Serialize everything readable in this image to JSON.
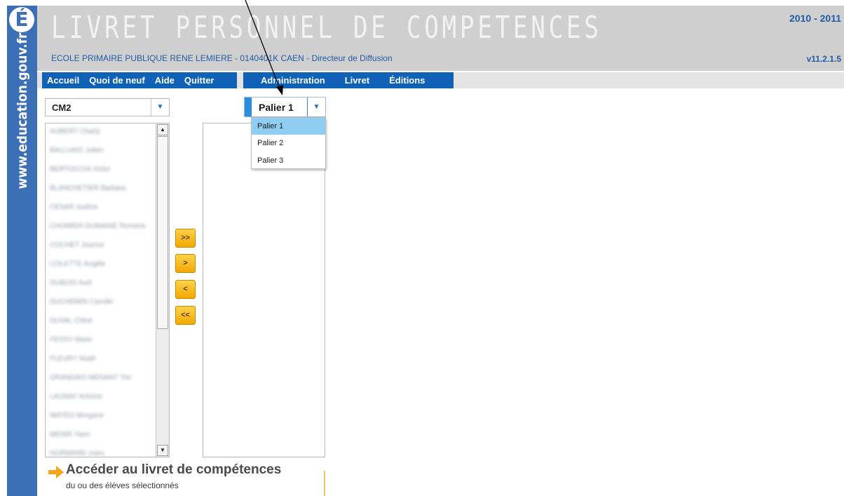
{
  "brand": {
    "logo_letter": "É",
    "url": "www.education.gouv.fr",
    "color": "#3b6fb6"
  },
  "header": {
    "title": "LIVRET PERSONNEL DE COMPETENCES",
    "school": "ECOLE PRIMAIRE PUBLIQUE RENE LEMIERE - 0140401K CAEN - Directeur de Diffusion",
    "year": "2010 - 2011",
    "version": "v11.2.1.5"
  },
  "nav": {
    "left": [
      "Accueil",
      "Quoi de neuf",
      "Aide",
      "Quitter"
    ],
    "right": [
      "Administration",
      "Livret",
      "Éditions"
    ],
    "color": "#0f62b6"
  },
  "class_select": {
    "value": "CM2"
  },
  "students": [
    "AUBERT Charly",
    "BALLUAIS Julien",
    "BERTOCCHI Victor",
    "BLANCHETIER Barbara",
    "CESAR Justine",
    "CHOMIER-DUMAINE Romane",
    "COCHET Jeanne",
    "COLETTE Angèle",
    "DUBOIS Axel",
    "DUCHEMIN Camille",
    "DUVAL Chloé",
    "FESSY Marie",
    "FLEURY Noah",
    "GRANDAIS-MENANT Tim",
    "LAUNAY Antoine",
    "MATÉO Morgane",
    "MENIR Yann",
    "NORMAND Jules"
  ],
  "transfer_buttons": [
    ">>",
    ">",
    "<",
    "<<"
  ],
  "palier": {
    "value": "Palier 1",
    "options": [
      "Palier 1",
      "Palier 2",
      "Palier 3"
    ],
    "highlight_color": "#8fcdf2"
  },
  "access": {
    "title": "Accéder au livret de compétences",
    "subtitle": "du ou des élèves sélectionnés"
  }
}
